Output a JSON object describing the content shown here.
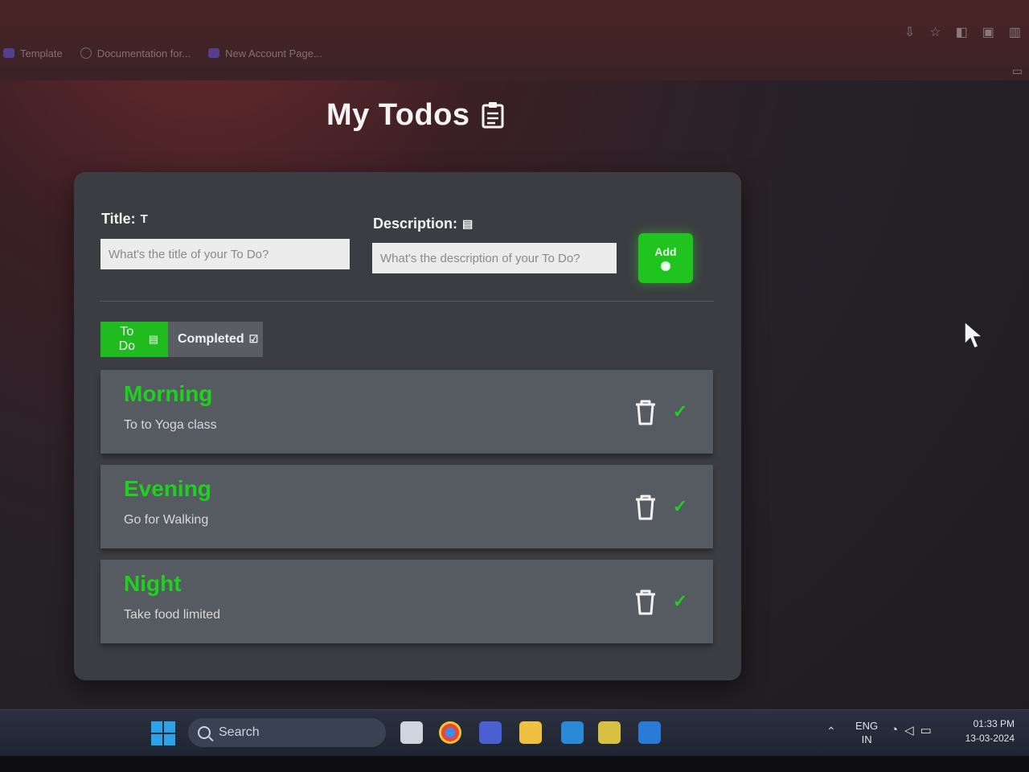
{
  "browser": {
    "bookmarks": [
      {
        "label": "Template",
        "icon": "app-icon"
      },
      {
        "label": "Documentation for...",
        "icon": "globe-icon"
      },
      {
        "label": "New Account Page...",
        "icon": "app-icon"
      }
    ]
  },
  "header": {
    "title": "My Todos",
    "icon": "clipboard-icon"
  },
  "form": {
    "title_label": "Title:",
    "title_label_icon": "T",
    "title_placeholder": "What's the title of your To Do?",
    "description_label": "Description:",
    "description_label_icon": "▤",
    "description_placeholder": "What's the description of your To Do?",
    "add_label": "Add"
  },
  "tabs": [
    {
      "label": "To Do",
      "icon": "▤",
      "active": true
    },
    {
      "label": "Completed",
      "icon": "☑",
      "active": false
    }
  ],
  "todos": [
    {
      "title": "Morning",
      "description": "To to Yoga class"
    },
    {
      "title": "Evening",
      "description": "Go for Walking"
    },
    {
      "title": "Night",
      "description": "Take food limited"
    }
  ],
  "colors": {
    "accent": "#1fc41f",
    "card_bg": "#3c3d42",
    "item_bg": "#565a61",
    "title_green": "#1fd11f"
  },
  "taskbar": {
    "search_label": "Search",
    "language_line1": "ENG",
    "language_line2": "IN",
    "time": "01:33 PM",
    "date": "13-03-2024"
  }
}
